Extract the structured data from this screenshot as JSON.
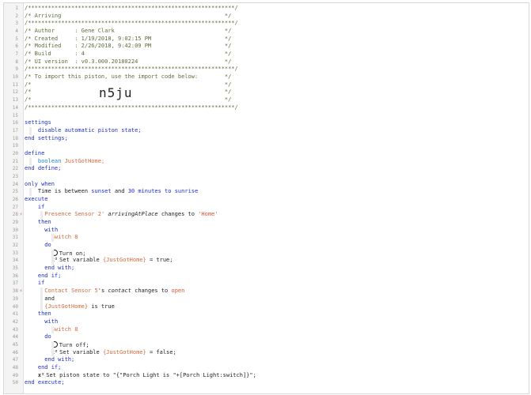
{
  "header": {
    "border": "/**************************************************************/",
    "title_line": "/* Arriving                                                 */",
    "author_line": "/* Author      : Gene Clark                                 */",
    "created_line": "/* Created     : 1/19/2018, 9:02:15 PM                      */",
    "modified_line": "/* Modified    : 2/26/2018, 9:42:09 PM                      */",
    "build_line": "/* Build       : 4                                          */",
    "ui_line": "/* UI version  : v0.3.000.20180224                          */",
    "import_line": "/* To import this piston, use the import code below:        */",
    "blank_line": "/*                                                          */",
    "import_code": "n5ju"
  },
  "code": {
    "settings": "settings",
    "disable": "disable automatic piston state;",
    "end_settings": "end settings;",
    "define": "define",
    "boolean": "boolean",
    "var_name": "JustGotHome;",
    "end_define": "end define;",
    "only_when": "only when",
    "time_is": "Time is between",
    "sunset": "sunset",
    "and": "and",
    "thirty": "30",
    "minutes_to": "minutes to",
    "sunrise": "sunrise",
    "execute": "execute",
    "if": "if",
    "presence_sensor": "Presence Sensor 2'",
    "arriving_attr": "arrivingAtPlace",
    "changes_to": "changes to",
    "home": "'Home'",
    "then": "then",
    "with": "with",
    "switch8": "Switch 8",
    "do": "do",
    "turn_on": "Turn on;",
    "set_variable": "Set variable",
    "jgh_var": "{JustGotHome}",
    "eq_true": "= true;",
    "end_with": "end with;",
    "end_if": "end if;",
    "contact_sensor": "Contact Sensor 5",
    "s_": "'s",
    "contact_attr": "contact",
    "open": "open",
    "and_kw": "and",
    "is_true": "is true",
    "turn_off": "Turn off;",
    "eq_false": "= false;",
    "set_piston": "Set piston state to",
    "piston_str": "\"{\"Porch Light is \"+[Porch Light:switch]}\";",
    "end_execute": "end execute;"
  },
  "line_numbers": [
    "1",
    "2",
    "3",
    "4",
    "5",
    "6",
    "7",
    "8",
    "9",
    "10",
    "11",
    "12",
    "13",
    "14",
    "15",
    "16",
    "17",
    "18",
    "19",
    "20",
    "21",
    "22",
    "23",
    "24",
    "25",
    "26",
    "27",
    "28",
    "29",
    "30",
    "31",
    "32",
    "33",
    "34",
    "35",
    "36",
    "37",
    "38",
    "39",
    "40",
    "41",
    "42",
    "43",
    "44",
    "45",
    "46",
    "47",
    "48",
    "49",
    "50"
  ],
  "colors": {
    "keyword": "#1c2ec9",
    "device": "#d2693a",
    "comment": "#5c6b3c",
    "string": "#d9532c"
  }
}
